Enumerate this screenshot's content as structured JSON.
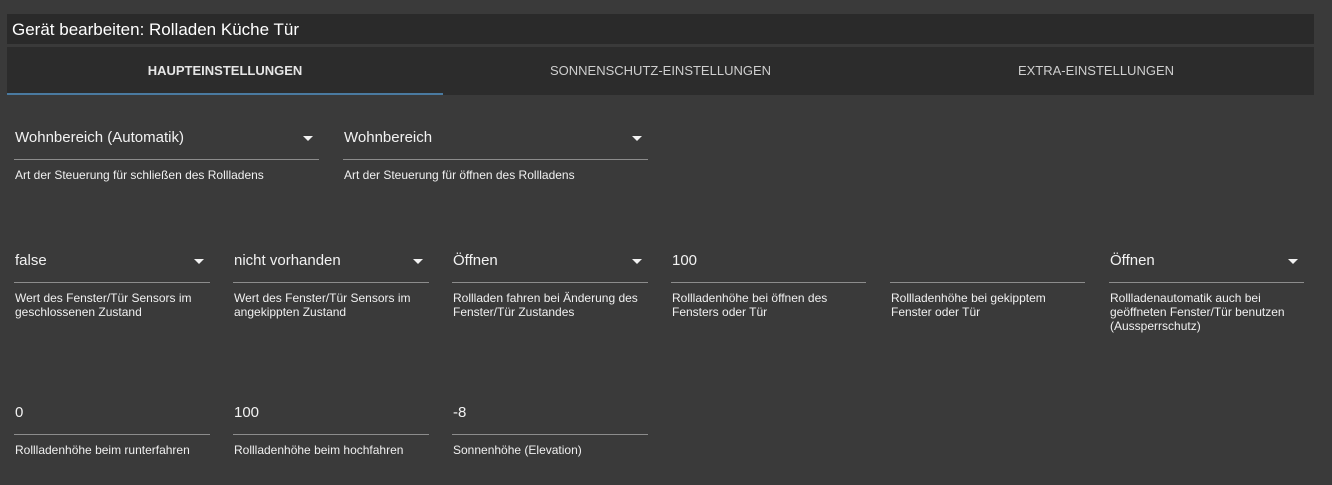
{
  "window": {
    "title": "Gerät bearbeiten: Rolladen Küche Tür"
  },
  "tabs": [
    {
      "label": "HAUPTEINSTELLUNGEN",
      "active": true
    },
    {
      "label": "SONNENSCHUTZ-EINSTELLUNGEN",
      "active": false
    },
    {
      "label": "EXTRA-EINSTELLUNGEN",
      "active": false
    }
  ],
  "row1": [
    {
      "value": "Wohnbereich (Automatik)",
      "helper": "Art der Steuerung für schließen des Rollladens",
      "type": "select"
    },
    {
      "value": "Wohnbereich",
      "helper": "Art der Steuerung für öffnen des Rollladens",
      "type": "select"
    }
  ],
  "row2": [
    {
      "value": "false",
      "helper": "Wert des Fenster/Tür Sensors im geschlossenen Zustand",
      "type": "select"
    },
    {
      "value": "nicht vorhanden",
      "helper": "Wert des Fenster/Tür Sensors im angekippten Zustand",
      "type": "select"
    },
    {
      "value": "Öffnen",
      "helper": "Rollladen fahren bei Änderung des Fenster/Tür Zustandes",
      "type": "select"
    },
    {
      "value": "100",
      "helper": "Rollladenhöhe bei öffnen des Fensters oder Tür",
      "type": "input"
    },
    {
      "value": "",
      "helper": "Rollladenhöhe bei gekipptem Fenster oder Tür",
      "type": "input"
    },
    {
      "value": "Öffnen",
      "helper": "Rollladenautomatik auch bei geöffneten Fenster/Tür benutzen (Aussperrschutz)",
      "type": "select"
    }
  ],
  "row3": [
    {
      "value": "0",
      "helper": "Rollladenhöhe beim runterfahren",
      "type": "input"
    },
    {
      "value": "100",
      "helper": "Rollladenhöhe beim hochfahren",
      "type": "input"
    },
    {
      "value": "-8",
      "helper": "Sonnenhöhe (Elevation)",
      "type": "input"
    }
  ],
  "colors": {
    "background": "#3a3a3a",
    "title_bar": "#2a2a2a",
    "tab_bar": "#2c2c2c",
    "tab_indicator": "#4a7aa0",
    "underline": "#8c8c8c"
  },
  "icons": {
    "select_arrow": "dropdown-arrow-icon"
  }
}
